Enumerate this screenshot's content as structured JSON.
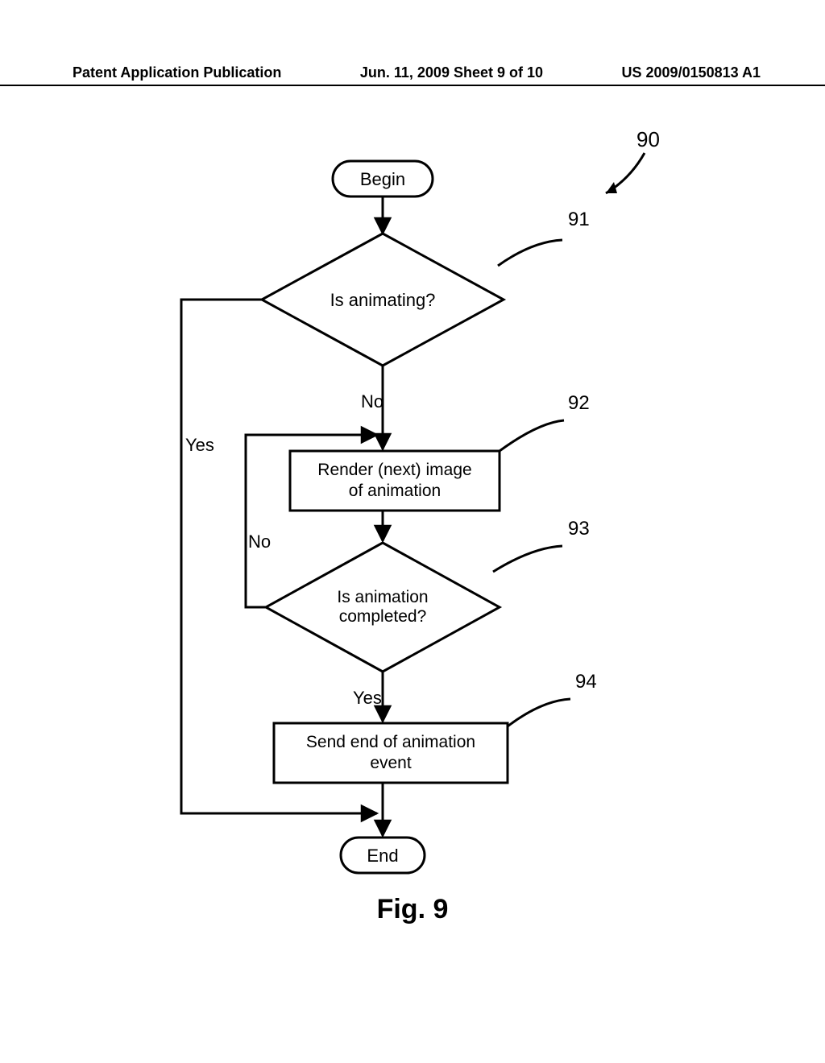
{
  "header": {
    "left": "Patent Application Publication",
    "center": "Jun. 11, 2009  Sheet 9 of 10",
    "right": "US 2009/0150813 A1"
  },
  "flow": {
    "begin": "Begin",
    "d1": "Is animating?",
    "p1_l1": "Render (next) image",
    "p1_l2": "of animation",
    "d2_l1": "Is animation",
    "d2_l2": "completed?",
    "p2_l1": "Send end of animation",
    "p2_l2": "event",
    "end": "End",
    "yes": "Yes",
    "no": "No"
  },
  "refs": {
    "r90": "90",
    "r91": "91",
    "r92": "92",
    "r93": "93",
    "r94": "94"
  },
  "figure": "Fig. 9"
}
